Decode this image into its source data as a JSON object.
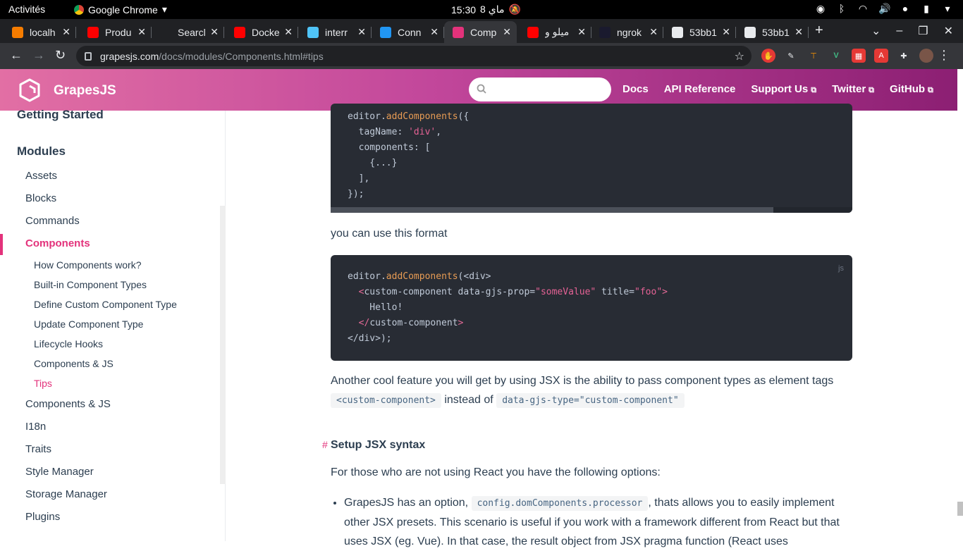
{
  "topbar": {
    "activities": "Activités",
    "app_name": "Google Chrome",
    "time": "15:30",
    "date": "8 ماي"
  },
  "tabs": [
    {
      "title": "localh",
      "favicon_color": "#f57c00"
    },
    {
      "title": "Produ",
      "favicon_color": "#ff0000"
    },
    {
      "title": "Searcl",
      "favicon_color": "#202124"
    },
    {
      "title": "Docke",
      "favicon_color": "#ff0000"
    },
    {
      "title": "interr",
      "favicon_color": "#4fc3f7"
    },
    {
      "title": "Conn",
      "favicon_color": "#2196f3"
    },
    {
      "title": "Comp",
      "favicon_color": "#e3327b",
      "active": true
    },
    {
      "title": "ميلو و",
      "favicon_color": "#ff0000"
    },
    {
      "title": "ngrok",
      "favicon_color": "#1a1a2e"
    },
    {
      "title": "53bb1",
      "favicon_color": "#e8eaed"
    },
    {
      "title": "53bb1",
      "favicon_color": "#e8eaed"
    }
  ],
  "omnibox": {
    "domain": "grapesjs.com",
    "path": "/docs/modules/Components.html#tips"
  },
  "site": {
    "brand": "GrapesJS",
    "search_placeholder": "",
    "nav": [
      {
        "label": "Docs",
        "external": false
      },
      {
        "label": "API Reference",
        "external": false
      },
      {
        "label": "Support Us",
        "external": true
      },
      {
        "label": "Twitter",
        "external": true
      },
      {
        "label": "GitHub",
        "external": true
      }
    ]
  },
  "sidebar": {
    "section_getting_started": "Getting Started",
    "section_modules": "Modules",
    "items": [
      {
        "label": "Assets"
      },
      {
        "label": "Blocks"
      },
      {
        "label": "Commands"
      },
      {
        "label": "Components",
        "active": true
      },
      {
        "label": "Components & JS"
      },
      {
        "label": "I18n"
      },
      {
        "label": "Traits"
      },
      {
        "label": "Style Manager"
      },
      {
        "label": "Storage Manager"
      },
      {
        "label": "Plugins"
      }
    ],
    "subitems": [
      {
        "label": "How Components work?"
      },
      {
        "label": "Built-in Component Types"
      },
      {
        "label": "Define Custom Component Type"
      },
      {
        "label": "Update Component Type"
      },
      {
        "label": "Lifecycle Hooks"
      },
      {
        "label": "Components & JS"
      },
      {
        "label": "Tips",
        "active": true
      }
    ]
  },
  "content": {
    "code1_lines": [
      "editor.addComponents({",
      "  tagName: 'div',",
      "  components: [",
      "    {...}",
      "  ],",
      "});"
    ],
    "para_use_format": "you can use this format",
    "code2_lang": "js",
    "code2_lines": [
      "editor.addComponents(<div>",
      "  <custom-component data-gjs-prop=\"someValue\" title=\"foo\">",
      "    Hello!",
      "  </custom-component>",
      "</div>);"
    ],
    "para_jsx_1": "Another cool feature you will get by using JSX is the ability to pass component types as element tags",
    "inline_code_tag": "<custom-component>",
    "para_jsx_instead": "instead of",
    "inline_code_attr": "data-gjs-type=\"custom-component\"",
    "heading_anchor": "#",
    "heading_setup": "Setup JSX syntax",
    "para_options": "For those who are not using React you have the following options:",
    "bullet_1_prefix": "GrapesJS has an option,",
    "bullet_1_code": "config.domComponents.processor",
    "bullet_1_suffix": ", thats allows you to easily implement other JSX presets. This scenario is useful if you work with a framework different from React but that uses JSX (eg. Vue). In that case, the result object from JSX pragma function (React uses"
  }
}
